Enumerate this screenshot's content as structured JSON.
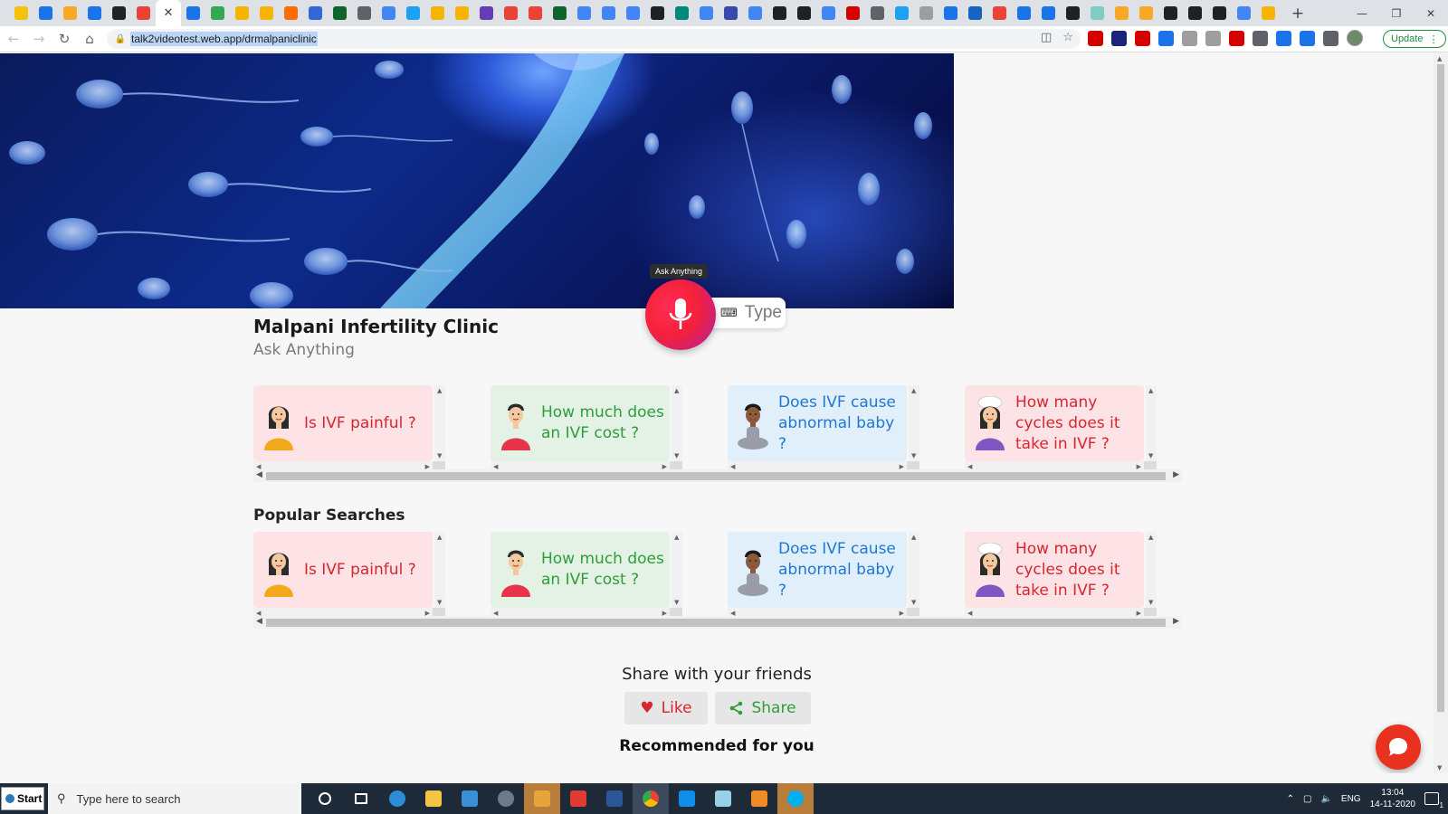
{
  "browser": {
    "address": "talk2videotest.web.app/drmalpaniclinic",
    "tab_close": "✕",
    "new_tab": "+",
    "update_label": "Update",
    "tab_favicon_colors": [
      "#f4c20d",
      "#1a73e8",
      "#f9a825",
      "#1a73e8",
      "#222222",
      "#ea4335",
      "#ffffff",
      "#1a73e8",
      "#34a853",
      "#f4b400",
      "#f4b400",
      "#ff6d00",
      "#3367d6",
      "#0d652d",
      "#5f6368",
      "#4285f4",
      "#1da1f2",
      "#f4b400",
      "#f4b400",
      "#673ab7",
      "#ea4335",
      "#ea4335",
      "#0d652d",
      "#4285f4",
      "#4285f4",
      "#4285f4",
      "#202124",
      "#00897b",
      "#4285f4",
      "#3949ab",
      "#4285f4",
      "#202124",
      "#202124",
      "#4285f4",
      "#d50000",
      "#5f6368",
      "#1da1f2",
      "#9e9e9e",
      "#1a73e8",
      "#1565c0",
      "#ea4335",
      "#1a73e8",
      "#1a73e8",
      "#202124",
      "#80cbc4",
      "#f9a825",
      "#f9a825",
      "#202124",
      "#202124",
      "#202124",
      "#4285f4",
      "#f4b400"
    ],
    "extension_colors": [
      "#d50000",
      "#1a237e",
      "#d50000",
      "#1a73e8",
      "#9e9e9e",
      "#9e9e9e",
      "#d50000",
      "#5f6368",
      "#1a73e8",
      "#1a73e8",
      "#5f6368"
    ]
  },
  "page": {
    "mic_tooltip": "Ask Anything",
    "type_label": "Type",
    "clinic_name": "Malpani Infertility Clinic",
    "clinic_subtitle": "Ask Anything",
    "popular_title": "Popular Searches",
    "share_title": "Share with your friends",
    "like_label": "Like",
    "share_label": "Share",
    "recommended_title": "Recommended for you",
    "row1": [
      {
        "question": "Is IVF painful ?",
        "theme": "pink",
        "avatar": "woman-avatar"
      },
      {
        "question": "How much does an IVF cost ?",
        "theme": "green",
        "avatar": "man-avatar"
      },
      {
        "question": "Does IVF cause abnormal baby ?",
        "theme": "blue",
        "avatar": "meditating-person-avatar"
      },
      {
        "question": "How many cycles does it take in IVF ?",
        "theme": "red",
        "avatar": "chef-woman-avatar"
      }
    ],
    "row2": [
      {
        "question": "Is IVF painful ?",
        "theme": "pink",
        "avatar": "woman-avatar"
      },
      {
        "question": "How much does an IVF cost ?",
        "theme": "green",
        "avatar": "man-avatar"
      },
      {
        "question": "Does IVF cause abnormal baby ?",
        "theme": "blue",
        "avatar": "meditating-person-avatar"
      },
      {
        "question": "How many cycles does it take in IVF ?",
        "theme": "red",
        "avatar": "chef-woman-avatar"
      }
    ]
  },
  "taskbar": {
    "start_label": "Start",
    "search_placeholder": "Type here to search",
    "language": "ENG",
    "time": "13:04",
    "date": "14-11-2020",
    "notification_count": "1"
  }
}
